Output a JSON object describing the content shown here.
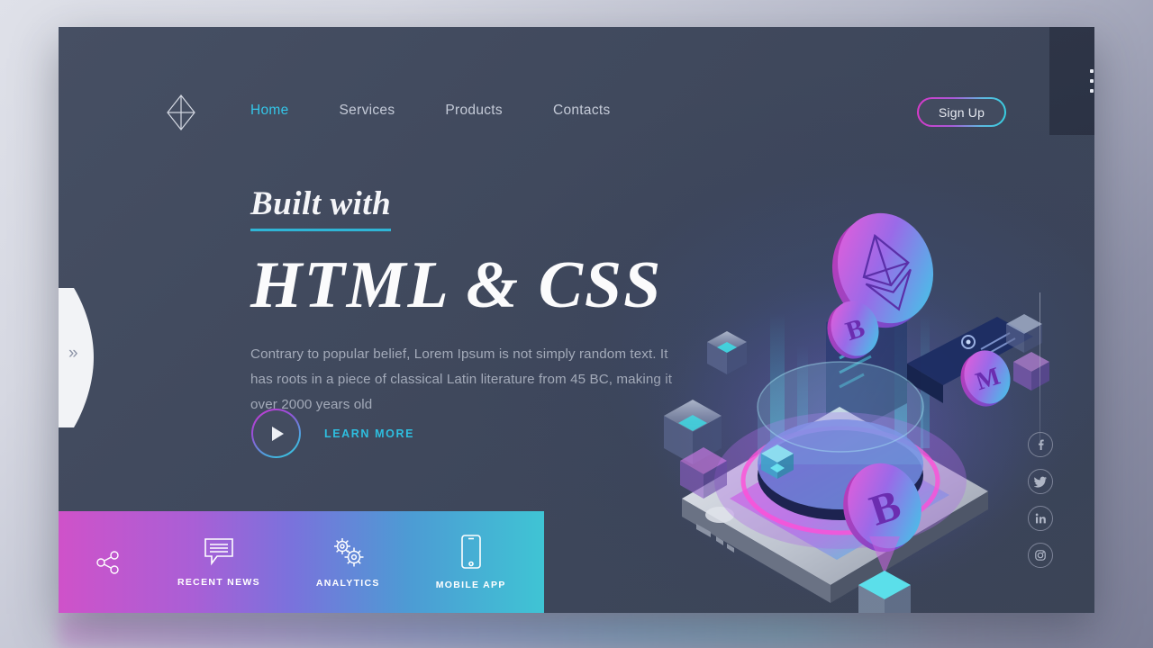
{
  "brand": {
    "logo_icon": "ethereum-diamond-icon"
  },
  "nav": {
    "items": [
      {
        "label": "Home",
        "active": true
      },
      {
        "label": "Services",
        "active": false
      },
      {
        "label": "Products",
        "active": false
      },
      {
        "label": "Contacts",
        "active": false
      }
    ]
  },
  "header": {
    "signup_label": "Sign Up",
    "grid_icon": "grid-menu-icon"
  },
  "edge": {
    "chevron": "»"
  },
  "hero": {
    "eyebrow": "Built with",
    "headline": "HTML & CSS",
    "paragraph": "Contrary to popular belief, Lorem Ipsum is not simply random text. It has roots in a piece of classical Latin literature from 45 BC, making it over 2000 years old",
    "cta_label": "LEARN MORE",
    "play_icon": "play-icon"
  },
  "features": {
    "share_icon": "share-nodes-icon",
    "items": [
      {
        "label": "RECENT NEWS",
        "icon": "chat-bubble-lines-icon"
      },
      {
        "label": "ANALYTICS",
        "icon": "gears-icon"
      },
      {
        "label": "MOBILE APP",
        "icon": "smartphone-icon"
      }
    ]
  },
  "socials": [
    {
      "name": "facebook",
      "glyph": "f"
    },
    {
      "name": "twitter",
      "glyph": "🐦"
    },
    {
      "name": "linkedin",
      "glyph": "in"
    },
    {
      "name": "instagram",
      "glyph": "▣"
    }
  ],
  "illustration": {
    "alt": "isometric smartphone with holographic crypto platform",
    "coins": [
      "ethereum",
      "bitcoin",
      "bitcoin",
      "monero"
    ]
  },
  "colors": {
    "card_bg": "#414a5e",
    "accent_cyan": "#34c6e8",
    "accent_magenta": "#cf52c9",
    "text_primary": "#fbfbfc",
    "text_muted": "#a3aab9"
  }
}
